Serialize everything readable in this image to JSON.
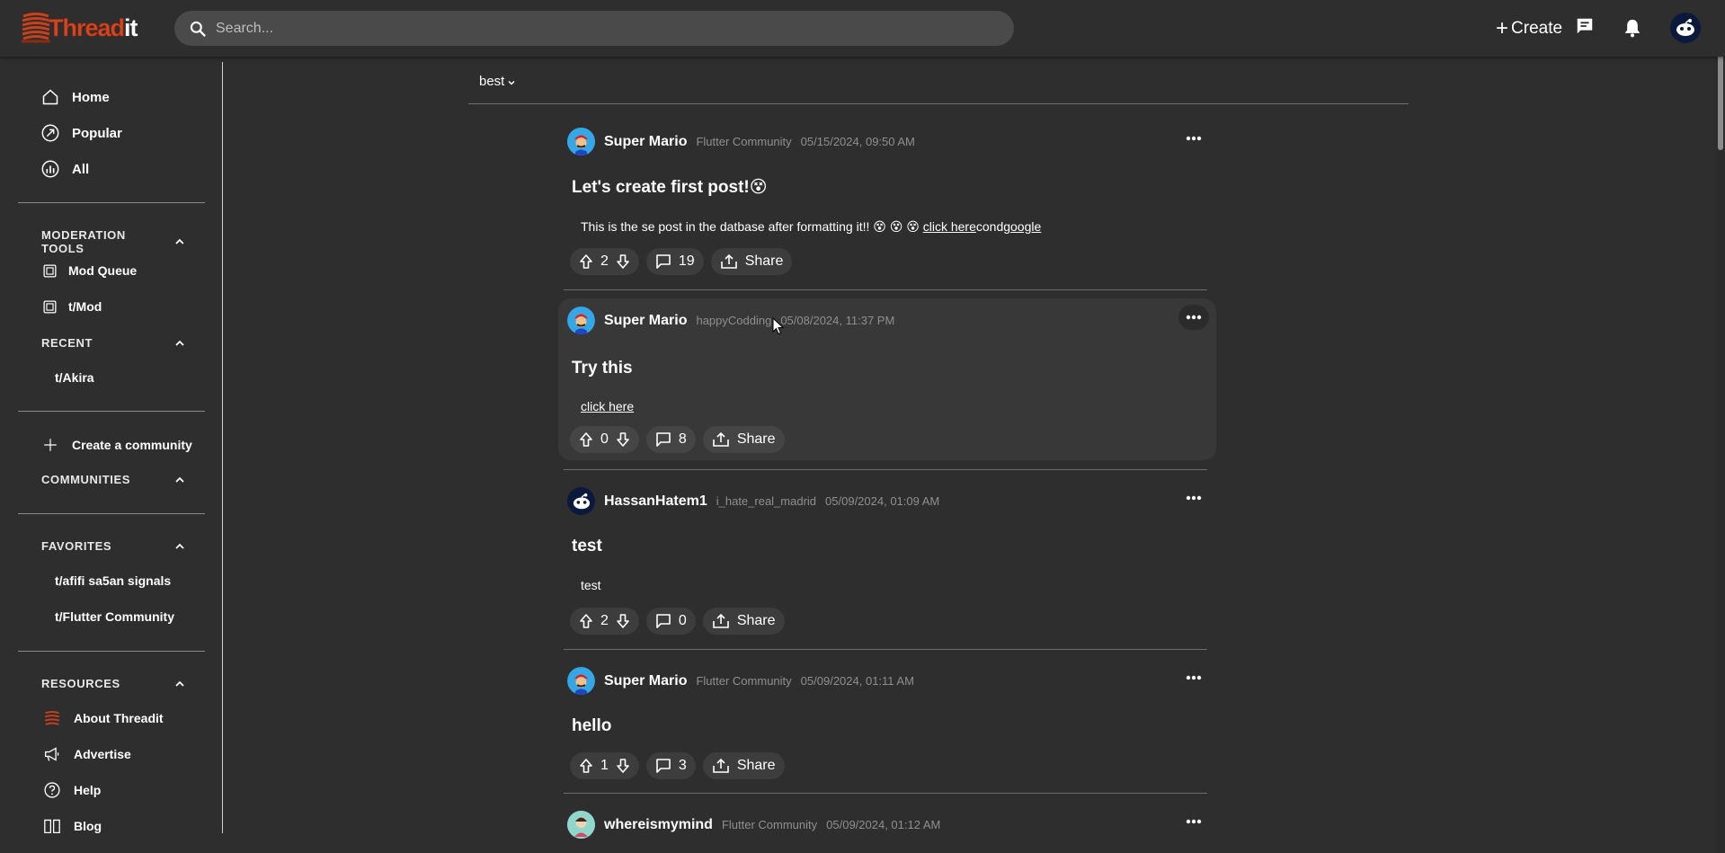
{
  "app": {
    "logo_part1": "Thread",
    "logo_part2": "it"
  },
  "search": {
    "placeholder": "Search..."
  },
  "header": {
    "create_label": "Create",
    "icons": [
      "chat-icon",
      "bell-icon",
      "avatar"
    ]
  },
  "sidebar": {
    "nav": [
      {
        "label": "Home",
        "icon": "home-icon"
      },
      {
        "label": "Popular",
        "icon": "trending-icon"
      },
      {
        "label": "All",
        "icon": "chart-icon"
      }
    ],
    "moderation": {
      "title": "MODERATION TOOLS",
      "items": [
        {
          "label": "Mod Queue"
        },
        {
          "label": "t/Mod"
        }
      ]
    },
    "recent": {
      "title": "RECENT",
      "items": [
        {
          "label": "t/Akira"
        }
      ]
    },
    "create_community": "Create a community",
    "communities": {
      "title": "COMMUNITIES"
    },
    "favorites": {
      "title": "FAVORITES",
      "items": [
        {
          "label": "t/afifi sa5an signals"
        },
        {
          "label": "t/Flutter Community"
        }
      ]
    },
    "resources": {
      "title": "RESOURCES",
      "items": [
        {
          "label": "About Threadit"
        },
        {
          "label": "Advertise"
        },
        {
          "label": "Help"
        },
        {
          "label": "Blog"
        }
      ]
    }
  },
  "feed": {
    "sort": "best",
    "posts": [
      {
        "user": "Super Mario",
        "community": "Flutter Community",
        "date": "05/15/2024, 09:50 AM",
        "title": "Let's create first post!",
        "title_emoji": "😵",
        "body_text": "This is the se post in the datbase after formatting it!! 😵 😵 😵 ",
        "body_link1": "click here",
        "body_mid": "cond",
        "body_link2": "google",
        "votes": "2",
        "comments": "19",
        "share": "Share"
      },
      {
        "user": "Super Mario",
        "community": "happyCodding",
        "date": "05/08/2024, 11:37 PM",
        "title": "Try this",
        "body_link1": "click here",
        "votes": "0",
        "comments": "8",
        "share": "Share"
      },
      {
        "user": "HassanHatem1",
        "community": "i_hate_real_madrid",
        "date": "05/09/2024, 01:09 AM",
        "title": "test",
        "body_text": "test",
        "votes": "2",
        "comments": "0",
        "share": "Share"
      },
      {
        "user": "Super Mario",
        "community": "Flutter Community",
        "date": "05/09/2024, 01:11 AM",
        "title": "hello",
        "votes": "1",
        "comments": "3",
        "share": "Share"
      },
      {
        "user": "whereismymind",
        "community": "Flutter Community",
        "date": "05/09/2024, 01:12 AM"
      }
    ]
  },
  "colors": {
    "background": "#2e2e2e",
    "search_bg": "#4a4a4a",
    "accent": "#d4441f",
    "muted_text": "#8f8f8f"
  }
}
